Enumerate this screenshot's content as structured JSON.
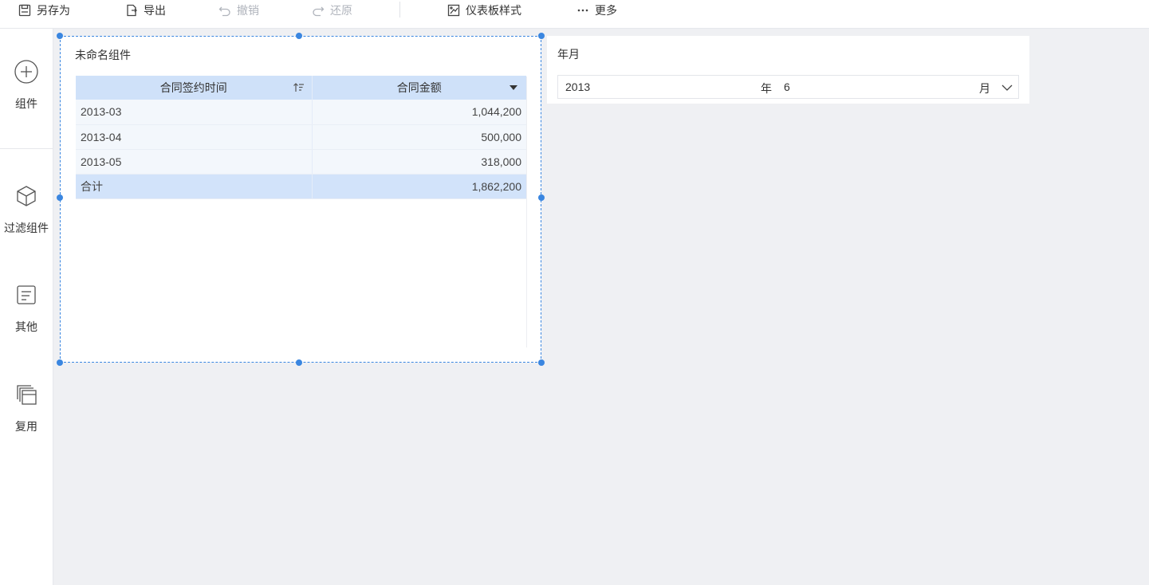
{
  "toolbar": {
    "save_as": "另存为",
    "export": "导出",
    "undo": "撤销",
    "redo": "还原",
    "dashboard_style": "仪表板样式",
    "more": "更多"
  },
  "sidebar": {
    "items": [
      {
        "label": "组件",
        "icon": "plus-circle-icon"
      },
      {
        "label": "过滤组件",
        "icon": "cube-icon"
      },
      {
        "label": "其他",
        "icon": "note-icon"
      },
      {
        "label": "复用",
        "icon": "stacked-cards-icon"
      }
    ]
  },
  "table_widget": {
    "title": "未命名组件",
    "columns": [
      "合同签约时间",
      "合同金额"
    ],
    "rows": [
      {
        "time": "2013-03",
        "amount": "1,044,200"
      },
      {
        "time": "2013-04",
        "amount": "500,000"
      },
      {
        "time": "2013-05",
        "amount": "318,000"
      }
    ],
    "total": {
      "label": "合计",
      "amount": "1,862,200"
    }
  },
  "filter_widget": {
    "title": "年月",
    "year": "2013",
    "year_unit": "年",
    "month": "6",
    "month_unit": "月"
  },
  "colors": {
    "accent": "#3a86e0",
    "header_bg": "#cfe1f9",
    "canvas_bg": "#eff0f3"
  }
}
